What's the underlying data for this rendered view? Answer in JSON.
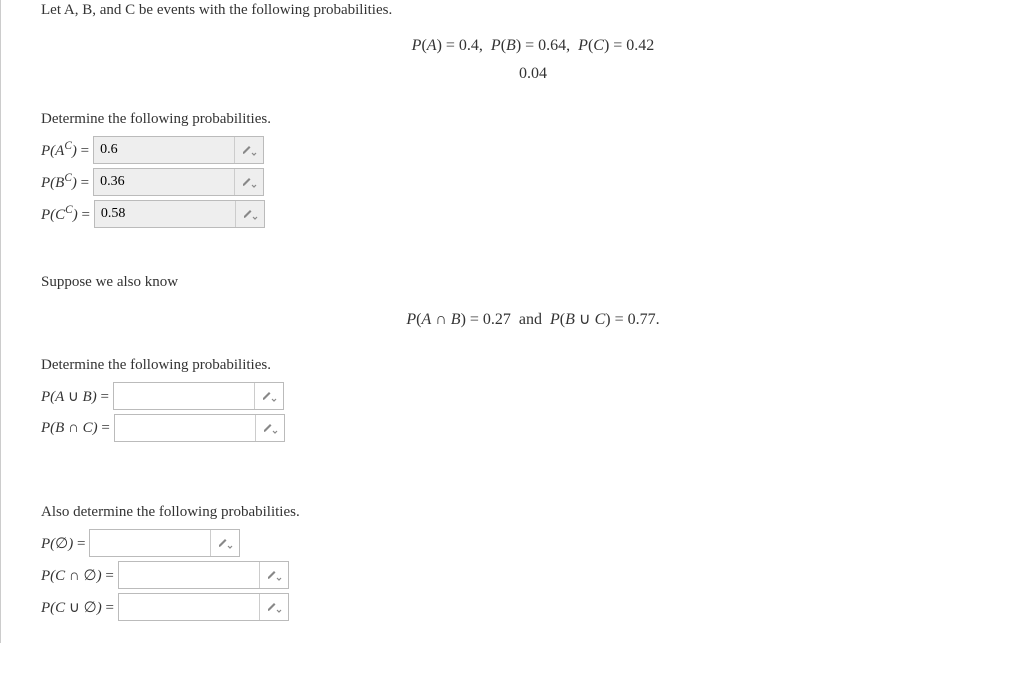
{
  "intro": "Let A, B, and C be events with the following probabilities.",
  "given_line": "P(A) = 0.4, P(B) = 0.64, P(C) = 0.42",
  "given_sub": "0.04",
  "section1": "Determine the following probabilities.",
  "rows1": [
    {
      "label_html": "P(A<sup>C</sup>) <span class='rm'>=</span>",
      "value": "0.6",
      "filled": true
    },
    {
      "label_html": "P(B<sup>C</sup>) <span class='rm'>=</span>",
      "value": "0.36",
      "filled": true
    },
    {
      "label_html": "P(C<sup>C</sup>) <span class='rm'>=</span>",
      "value": "0.58",
      "filled": true
    }
  ],
  "suppose": "Suppose we also know",
  "given_line2": "P(A ∩ B) = 0.27 and P(B ∪ C) = 0.77.",
  "section2": "Determine the following probabilities.",
  "rows2": [
    {
      "label_html": "P(A <span class='rm'>∪</span> B) <span class='rm'>=</span>",
      "value": "",
      "filled": false
    },
    {
      "label_html": "P(B <span class='rm'>∩</span> C) <span class='rm'>=</span>",
      "value": "",
      "filled": false
    }
  ],
  "section3": "Also determine the following probabilities.",
  "rows3": [
    {
      "label_html": "P(<span class='rm'>∅</span>) <span class='rm'>=</span>",
      "value": "",
      "filled": false,
      "width": 120
    },
    {
      "label_html": "P(C <span class='rm'>∩ ∅</span>) <span class='rm'>=</span>",
      "value": "",
      "filled": false
    },
    {
      "label_html": "P(C <span class='rm'>∪ ∅</span>) <span class='rm'>=</span>",
      "value": "",
      "filled": false
    }
  ]
}
